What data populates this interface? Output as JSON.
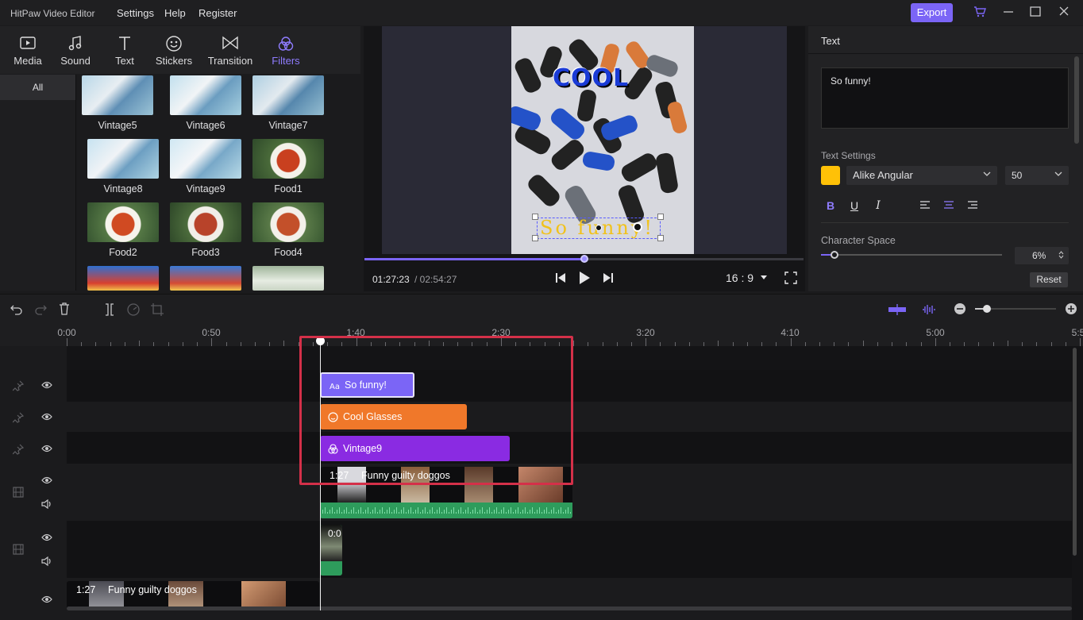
{
  "app": {
    "title": "HitPaw Video Editor",
    "menus": [
      "Settings",
      "Help",
      "Register"
    ],
    "export_label": "Export"
  },
  "tools": [
    {
      "label": "Media",
      "icon": "media-icon"
    },
    {
      "label": "Sound",
      "icon": "music-note-icon"
    },
    {
      "label": "Text",
      "icon": "text-t-icon"
    },
    {
      "label": "Stickers",
      "icon": "smiley-icon"
    },
    {
      "label": "Transition",
      "icon": "bowtie-icon"
    },
    {
      "label": "Filters",
      "icon": "filters-icon"
    }
  ],
  "categories": {
    "selected": "All"
  },
  "filters": [
    "Vintage5",
    "Vintage6",
    "Vintage7",
    "Vintage8",
    "Vintage9",
    "Food1",
    "Food2",
    "Food3",
    "Food4"
  ],
  "preview": {
    "overlay_text": "COOL",
    "caption": "So funny!",
    "time_current": "01:27:23",
    "time_total": "/ 02:54:27",
    "progress": 0.5,
    "ratio": "16 : 9"
  },
  "props": {
    "title": "Text",
    "text_value": "So funny!",
    "settings_label": "Text Settings",
    "color": "#ffc107",
    "font": "Alike Angular",
    "size": "50",
    "bold": "B",
    "underline": "U",
    "italic": "I",
    "char_space_label": "Character Space",
    "char_space_value": "6%",
    "reset_label": "Reset"
  },
  "timeline": {
    "ruler": [
      "0:00",
      "0:50",
      "1:40",
      "2:30",
      "3:20",
      "4:10",
      "5:00",
      "5:5"
    ],
    "clips": {
      "text": "So funny!",
      "sticker": "Cool Glasses",
      "filter": "Vintage9",
      "video1_time": "1:27",
      "video1_name": "Funny guilty doggos",
      "video2_time": "0:0",
      "video3_time": "1:27",
      "video3_name": "Funny guilty doggos"
    }
  },
  "colors": {
    "accent": "#7b65f6",
    "text_clip": "#7b65f6",
    "sticker_clip": "#f0782a",
    "filter_clip": "#8a2be2",
    "audio": "#2e9c5c",
    "highlight": "#d43049"
  }
}
